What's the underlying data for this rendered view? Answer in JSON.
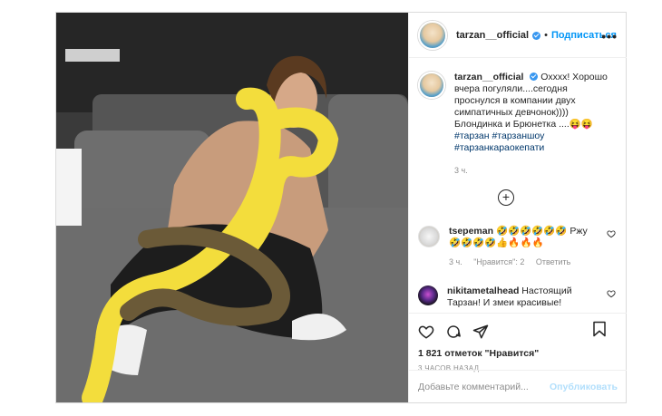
{
  "post": {
    "username": "tarzan__official",
    "dot": "•",
    "follow_label": "Подписаться",
    "more": "•••",
    "caption": {
      "username": "tarzan__official",
      "text": "Охххх! Хорошо вчера погуляли....сегодня проснулся в компании двух симпатичных девчонок)))) Блондинка и Брюнетка ....😝😝",
      "hashtags": "#тарзан #тарзаншоу #тарзанкараокепати",
      "time": "3 ч."
    },
    "load_more": "+",
    "comments": [
      {
        "username": "tsepeman",
        "text": "🤣🤣🤣🤣🤣🤣 Ржу 🤣🤣🤣🤣👍🔥🔥🔥",
        "time": "3 ч.",
        "likes": "\"Нравится\": 2",
        "reply": "Ответить"
      },
      {
        "username": "nikitametalhead",
        "text": "Настоящий Тарзан! И змеи красивые!"
      }
    ],
    "likes_text": "1 821 отметок \"Нравится\"",
    "posted_ago": "3 ЧАСОВ НАЗАД",
    "comment_placeholder": "Добавьте комментарий...",
    "publish_label": "Опубликовать"
  },
  "colors": {
    "link": "#0095f6",
    "hashtag": "#00376b",
    "muted": "#8e8e8e",
    "border": "#dbdbdb",
    "snake_yellow": "#f3dd3c"
  }
}
